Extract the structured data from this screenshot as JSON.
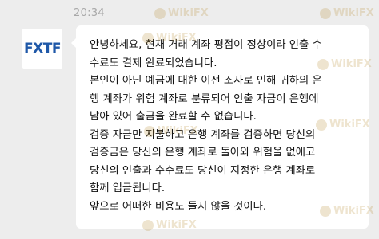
{
  "timestamp": "20:34",
  "sender": {
    "logo_text": "FXTF"
  },
  "message": {
    "lines": [
      "안녕하세요, 현재 거래 계좌 평점이 정상이라 인출 수",
      "수료도 결제 완료되었습니다.",
      "본인이 아닌 예금에 대한 이전 조사로 인해 귀하의 은",
      "행 계좌가 위험 계좌로 분류되어 인출 자금이 은행에",
      "남아 있어 출금을 완료할 수 없습니다.",
      "검증 자금만 지불하고 은행 계좌를 검증하면 당신의",
      "검증금은 당신의 은행 계좌로 돌아와 위험을 없애고",
      "당신의 인출과 수수료도 당신이 지정한 은행 계좌로",
      "함께 입금됩니다.",
      "앞으로 어떠한 비용도 들지 않을 것이다."
    ]
  },
  "watermark": {
    "text": "WikiFX"
  }
}
